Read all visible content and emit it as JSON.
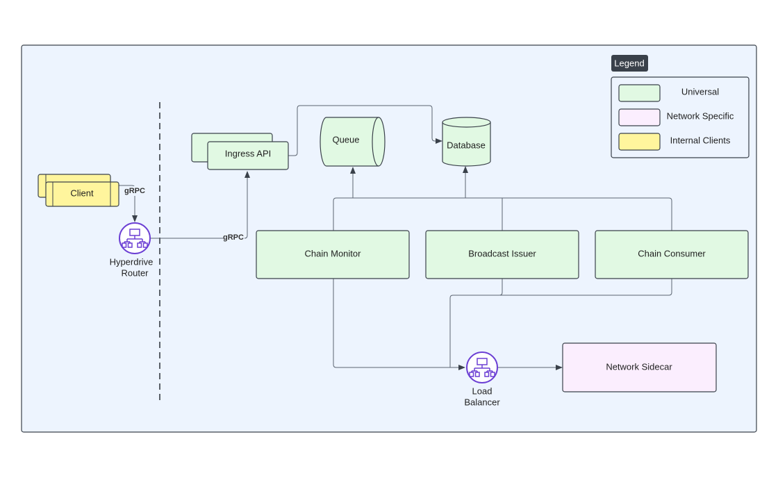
{
  "colors": {
    "background": "#edf4fe",
    "universal": "#e1f9e3",
    "network_specific": "#fbeefe",
    "internal_clients": "#fff59d",
    "router_icon": "#6b3fd4",
    "legend_title_bg": "#3a414a"
  },
  "legend": {
    "title": "Legend",
    "items": [
      {
        "label": "Universal",
        "color": "#e1f9e3"
      },
      {
        "label": "Network Specific",
        "color": "#fbeefe"
      },
      {
        "label": "Internal Clients",
        "color": "#fff59d"
      }
    ]
  },
  "nodes": {
    "client": "Client",
    "router_line1": "Hyperdrive",
    "router_line2": "Router",
    "ingress": "Ingress API",
    "queue": "Queue",
    "database": "Database",
    "chain_monitor": "Chain Monitor",
    "broadcast_issuer": "Broadcast Issuer",
    "chain_consumer": "Chain Consumer",
    "lb_line1": "Load",
    "lb_line2": "Balancer",
    "network_sidecar": "Network Sidecar"
  },
  "edges": {
    "client_router": "gRPC",
    "router_ingress": "gRPC"
  },
  "icons": {
    "router": "network-hierarchy-icon",
    "load_balancer": "network-hierarchy-icon"
  }
}
